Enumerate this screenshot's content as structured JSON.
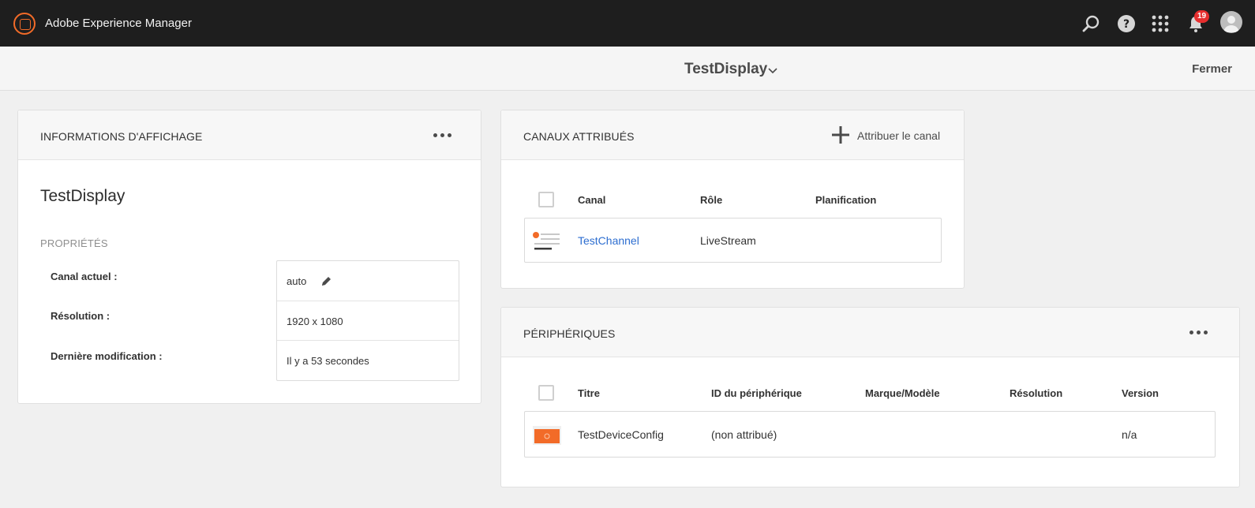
{
  "shell": {
    "app_title": "Adobe Experience Manager",
    "notification_count": "19"
  },
  "titlebar": {
    "title": "TestDisplay",
    "close_label": "Fermer"
  },
  "display_info": {
    "header": "INFORMATIONS D'AFFICHAGE",
    "display_name": "TestDisplay",
    "properties_label": "PROPRIÉTÉS",
    "properties": [
      {
        "label": "Canal actuel :",
        "value": "auto"
      },
      {
        "label": "Résolution :",
        "value": "1920 x 1080"
      },
      {
        "label": "Dernière modification :",
        "value": "Il y a 53 secondes"
      }
    ]
  },
  "channels": {
    "header": "CANAUX ATTRIBUÉS",
    "assign_label": "Attribuer le canal",
    "columns": [
      "Canal",
      "Rôle",
      "Planification"
    ],
    "rows": [
      {
        "channel": "TestChannel",
        "role": "LiveStream",
        "schedule": ""
      }
    ]
  },
  "devices": {
    "header": "PÉRIPHÉRIQUES",
    "columns": [
      "Titre",
      "ID du périphérique",
      "Marque/Modèle",
      "Résolution",
      "Version"
    ],
    "rows": [
      {
        "title": "TestDeviceConfig",
        "device_id": "(non attribué)",
        "model": "",
        "resolution": "",
        "version": "n/a"
      }
    ]
  },
  "colors": {
    "shell_bg": "#1e1e1e",
    "accent_orange": "#f26b28",
    "link_blue": "#2d6ed0",
    "badge_red": "#e62e2e"
  }
}
